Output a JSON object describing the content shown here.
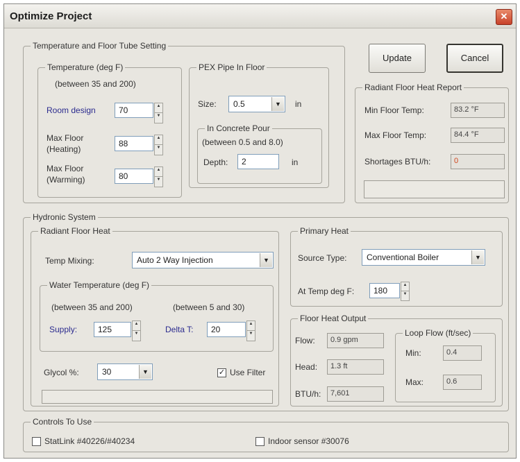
{
  "window": {
    "title": "Optimize Project",
    "close_glyph": "✕"
  },
  "buttons": {
    "update": "Update",
    "cancel": "Cancel"
  },
  "temp_tube": {
    "legend": "Temperature and Floor Tube Setting",
    "temperature": {
      "legend": "Temperature (deg F)",
      "range": "(between 35 and 200)",
      "room_design_label": "Room design",
      "room_design_value": "70",
      "max_heating_label_1": "Max Floor",
      "max_heating_label_2": "(Heating)",
      "max_heating_value": "88",
      "max_warming_label_1": "Max Floor",
      "max_warming_label_2": "(Warming)",
      "max_warming_value": "80"
    },
    "pex": {
      "legend": "PEX Pipe In Floor",
      "size_label": "Size:",
      "size_value": "0.5",
      "size_unit": "in",
      "concrete_legend": "In Concrete Pour",
      "concrete_range": "(between 0.5 and 8.0)",
      "depth_label": "Depth:",
      "depth_value": "2",
      "depth_unit": "in"
    }
  },
  "report": {
    "legend": "Radiant Floor Heat Report",
    "min_label": "Min Floor Temp:",
    "min_value": "83.2 °F",
    "max_label": "Max Floor Temp:",
    "max_value": "84.4 °F",
    "short_label": "Shortages BTU/h:",
    "short_value": "0"
  },
  "hydronic": {
    "legend": "Hydronic System",
    "radiant": {
      "legend": "Radiant Floor Heat",
      "mixing_label": "Temp Mixing:",
      "mixing_value": "Auto 2 Way Injection",
      "water_legend": "Water Temperature (deg F)",
      "range1": "(between 35 and 200)",
      "range2": "(between 5 and 30)",
      "supply_label": "Supply:",
      "supply_value": "125",
      "delta_label": "Delta T:",
      "delta_value": "20",
      "glycol_label": "Glycol %:",
      "glycol_value": "30",
      "use_filter_label": "Use Filter",
      "use_filter_checked": true,
      "check_glyph": "✓"
    },
    "primary": {
      "legend": "Primary Heat",
      "source_label": "Source Type:",
      "source_value": "Conventional Boiler",
      "attemp_label": "At Temp deg F:",
      "attemp_value": "180"
    },
    "output": {
      "legend": "Floor Heat Output",
      "flow_label": "Flow:",
      "flow_value": "0.9 gpm",
      "head_label": "Head:",
      "head_value": "1.3 ft",
      "btuh_label": "BTU/h:",
      "btuh_value": "7,601",
      "loop_legend": "Loop Flow (ft/sec)",
      "min_label": "Min:",
      "min_value": "0.4",
      "max_label": "Max:",
      "max_value": "0.6"
    }
  },
  "controls": {
    "legend": "Controls To Use",
    "statlink_label": "StatLink #40226/#40234",
    "indoor_label": "Indoor sensor #30076"
  },
  "icons": {
    "spin_up": "▲",
    "spin_down": "▼",
    "dropdown": "▼"
  }
}
